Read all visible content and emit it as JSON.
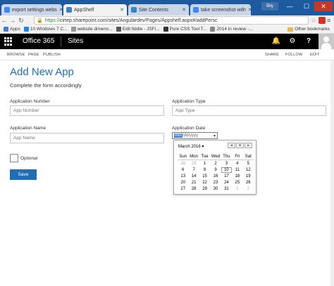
{
  "browser": {
    "tabs": [
      {
        "title": "export settings webs",
        "color": "#4285f4"
      },
      {
        "title": "AppShelf",
        "color": "#3b82c4"
      },
      {
        "title": "Site Contents",
        "color": "#3b82c4"
      },
      {
        "title": "take screenshot with",
        "color": "#4285f4"
      }
    ],
    "user": "Bily",
    "address": {
      "scheme": "https://",
      "url": "cirtep.sharepoint.com/sites/Angulardev/Pages/Appshelf.aspx#/addPersc"
    },
    "bookmarks": [
      {
        "label": "Apps",
        "color": "#4a7bd0"
      },
      {
        "label": "10 Windows 7 C...",
        "color": "#1e88e5"
      },
      {
        "label": "website dimens...",
        "color": "#999999"
      },
      {
        "label": "Edit fiddle - JSFi...",
        "color": "#555555"
      },
      {
        "label": "Pure CSS Tool T...",
        "color": "#333333"
      },
      {
        "label": "2014 in review -...",
        "color": "#888888"
      }
    ],
    "other_bookmarks": "Other bookmarks"
  },
  "suitebar": {
    "brand": "Office 365",
    "site": "Sites"
  },
  "ribbon": {
    "left": [
      "BROWSE",
      "PAGE",
      "PUBLISH"
    ],
    "right": [
      "SHARE",
      "FOLLOW",
      "EDIT"
    ]
  },
  "page": {
    "title": "Add New App",
    "subtitle": "Complete the form accordingly"
  },
  "form": {
    "app_number_label": "Application Number",
    "app_number_placeholder": "App Number",
    "app_type_label": "Application Type",
    "app_type_placeholder": "App Type",
    "app_name_label": "Application Name",
    "app_name_placeholder": "App Name",
    "app_date_label": "Application Date",
    "app_date_value": {
      "mm": "mm",
      "rest": "/dd/yyyy"
    },
    "optional_label": "Optional",
    "save_label": "Save"
  },
  "calendar": {
    "month": "March 2016",
    "weekdays": [
      "Sun",
      "Mon",
      "Tue",
      "Wed",
      "Thu",
      "Fri",
      "Sat"
    ],
    "weeks": [
      [
        "28",
        "29",
        "1",
        "2",
        "3",
        "4",
        "5"
      ],
      [
        "6",
        "7",
        "8",
        "9",
        "10",
        "11",
        "12"
      ],
      [
        "13",
        "14",
        "15",
        "16",
        "17",
        "18",
        "19"
      ],
      [
        "20",
        "21",
        "22",
        "23",
        "24",
        "25",
        "26"
      ],
      [
        "27",
        "28",
        "29",
        "30",
        "31",
        "1",
        "2"
      ]
    ],
    "today": "10"
  }
}
